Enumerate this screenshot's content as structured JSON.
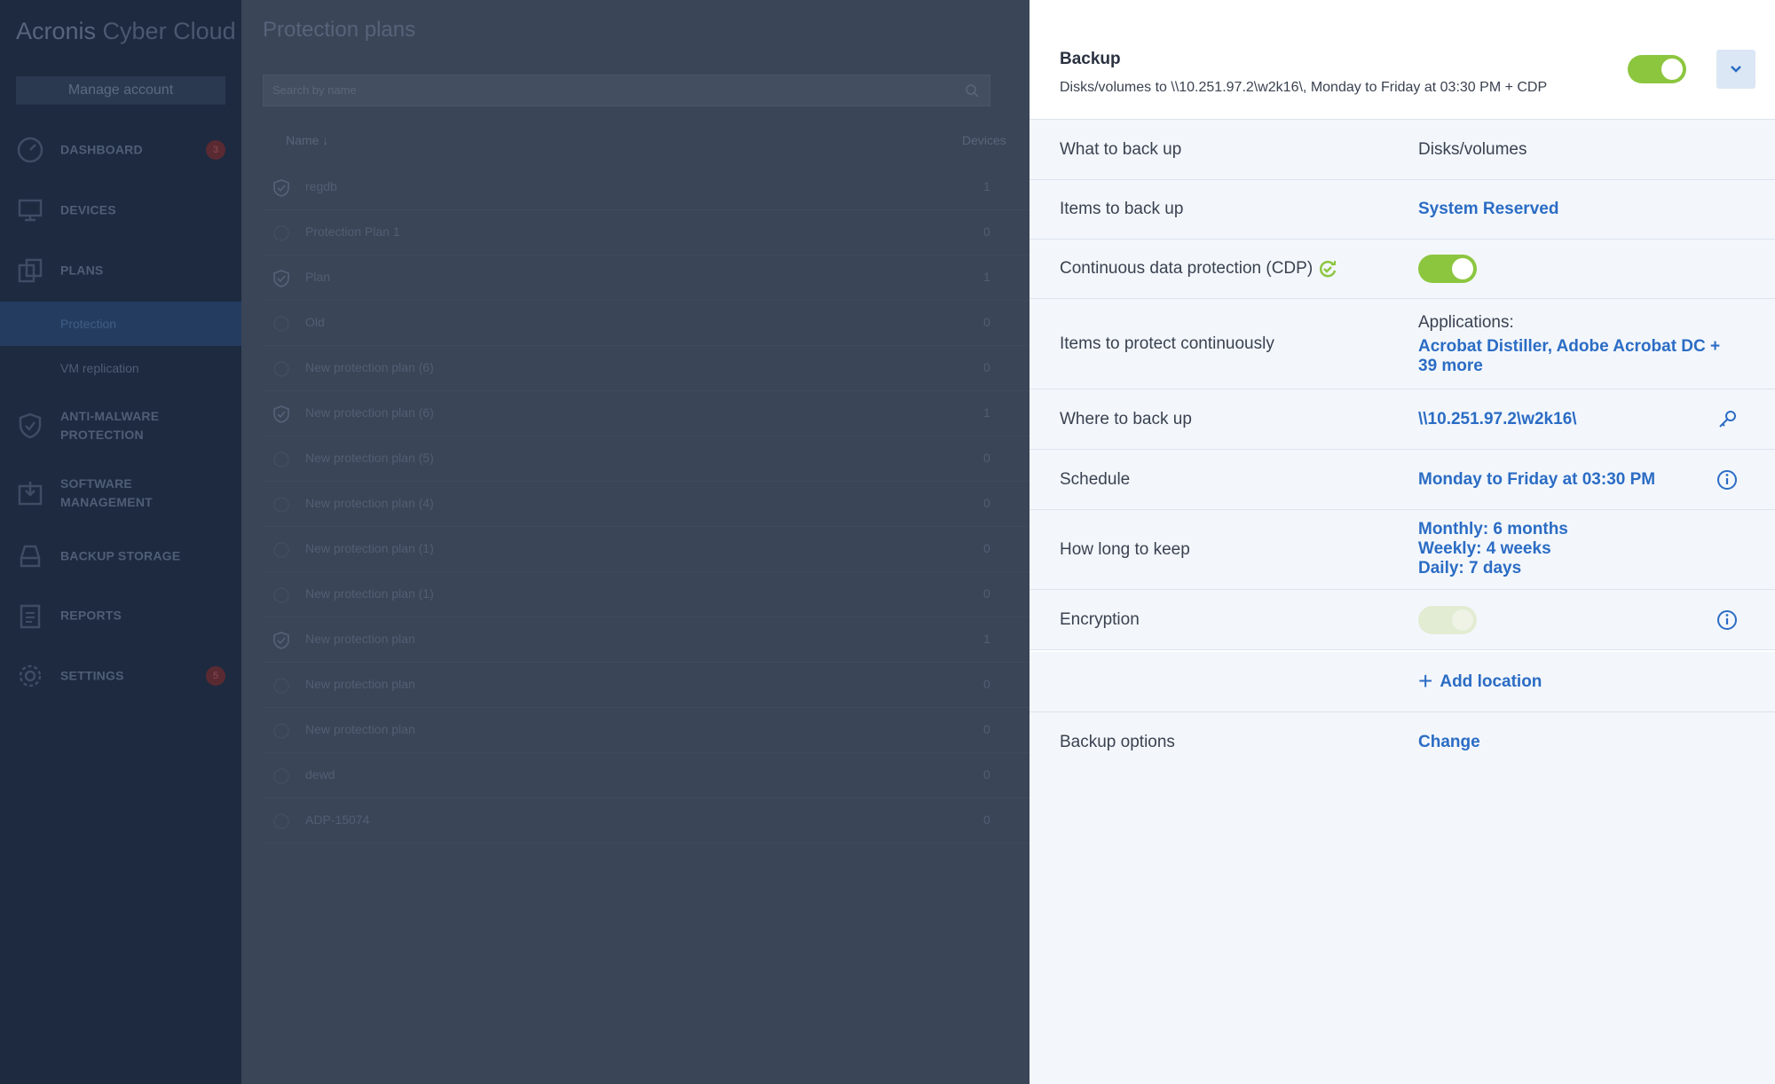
{
  "sidebar": {
    "brand_bold": "Acronis",
    "brand_light": "Cyber Cloud",
    "manage_account": "Manage account",
    "items": [
      {
        "label": "DASHBOARD",
        "badge": "3"
      },
      {
        "label": "DEVICES"
      },
      {
        "label": "PLANS"
      },
      {
        "label": "Protection"
      },
      {
        "label": "VM replication"
      },
      {
        "label": "ANTI-MALWARE PROTECTION"
      },
      {
        "label": "SOFTWARE MANAGEMENT"
      },
      {
        "label": "BACKUP STORAGE"
      },
      {
        "label": "REPORTS"
      },
      {
        "label": "SETTINGS",
        "badge": "5"
      }
    ]
  },
  "main": {
    "title": "Protection plans",
    "search_placeholder": "Search by name",
    "col_name": "Name",
    "col_devices": "Devices",
    "rows": [
      {
        "name": "regdb",
        "devices": "1",
        "checked": true
      },
      {
        "name": "Protection Plan 1",
        "devices": "0",
        "checked": false
      },
      {
        "name": "Plan",
        "devices": "1",
        "checked": true
      },
      {
        "name": "Old",
        "devices": "0",
        "checked": false
      },
      {
        "name": "New protection plan (6)",
        "devices": "0",
        "checked": false
      },
      {
        "name": "New protection plan (6)",
        "devices": "1",
        "checked": true
      },
      {
        "name": "New protection plan (5)",
        "devices": "0",
        "checked": false
      },
      {
        "name": "New protection plan (4)",
        "devices": "0",
        "checked": false
      },
      {
        "name": "New protection plan (1)",
        "devices": "0",
        "checked": false
      },
      {
        "name": "New protection plan (1)",
        "devices": "0",
        "checked": false
      },
      {
        "name": "New protection plan",
        "devices": "1",
        "checked": true
      },
      {
        "name": "New protection plan",
        "devices": "0",
        "checked": false
      },
      {
        "name": "New protection plan",
        "devices": "0",
        "checked": false
      },
      {
        "name": "dewd",
        "devices": "0",
        "checked": false
      },
      {
        "name": "ADP-15074",
        "devices": "0",
        "checked": false
      }
    ]
  },
  "panel": {
    "title": "Backup",
    "subtitle": "Disks/volumes to \\\\10.251.97.2\\w2k16\\, Monday to Friday at 03:30 PM + CDP",
    "backup_enabled": true,
    "rows": {
      "what_label": "What to back up",
      "what_value": "Disks/volumes",
      "items_label": "Items to back up",
      "items_value": "System Reserved",
      "cdp_label": "Continuous data protection (CDP)",
      "cdp_enabled": true,
      "protect_label": "Items to protect continuously",
      "protect_heading": "Applications:",
      "protect_line1": "Acrobat Distiller, Adobe Acrobat DC +",
      "protect_line2": "39 more",
      "where_label": "Where to back up",
      "where_value": "\\\\10.251.97.2\\w2k16\\",
      "schedule_label": "Schedule",
      "schedule_value": "Monday to Friday at 03:30 PM",
      "keep_label": "How long to keep",
      "keep_monthly": "Monthly: 6 months",
      "keep_weekly": "Weekly: 4 weeks",
      "keep_daily": "Daily: 7 days",
      "encryption_label": "Encryption",
      "encryption_enabled": false,
      "add_location": "Add location",
      "options_label": "Backup options",
      "options_value": "Change"
    }
  },
  "colors": {
    "accent_green": "#8cc63f",
    "link_blue": "#2b6cc4",
    "sidebar_bg": "#1d2a3f",
    "panel_row_bg": "#f3f7fc"
  }
}
